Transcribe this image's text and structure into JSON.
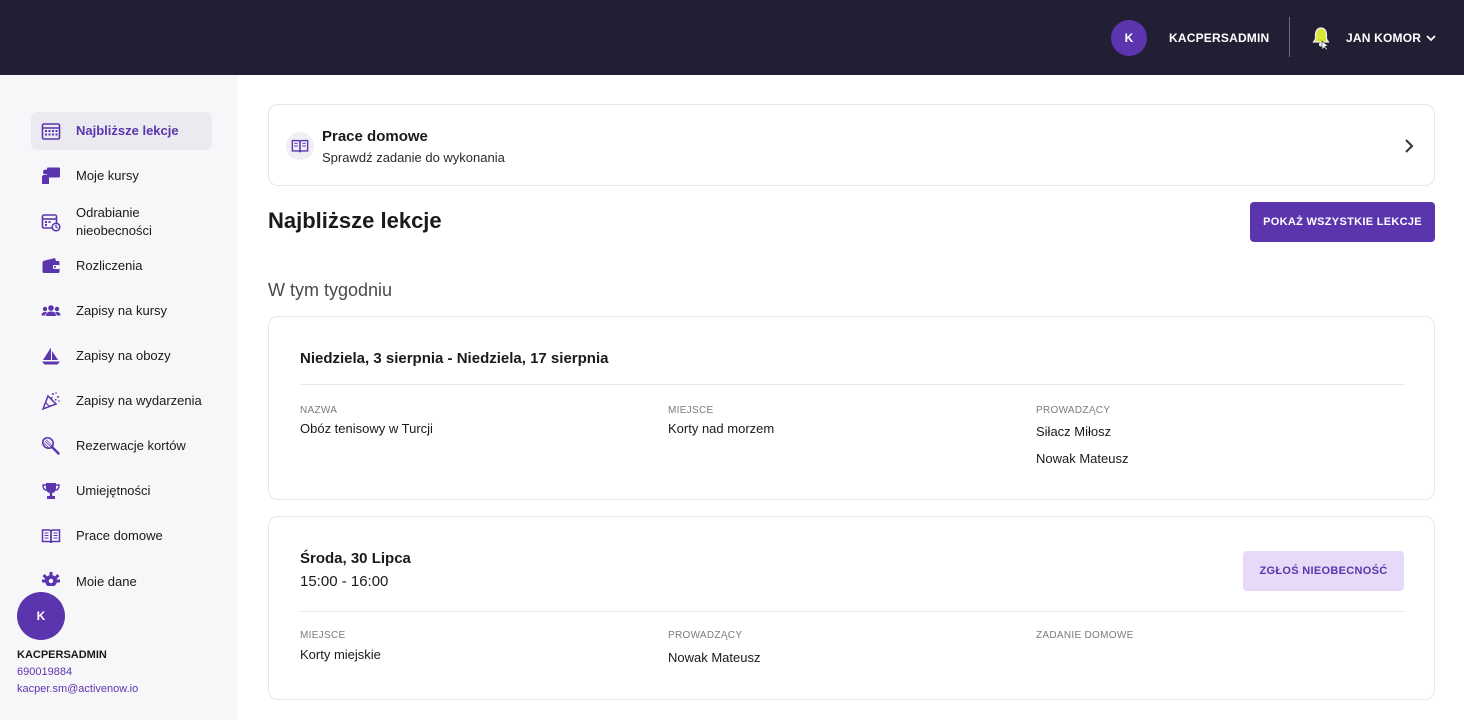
{
  "header": {
    "avatar_initial": "K",
    "username": "KACPERSADMIN",
    "user_name": "JAN KOMOR"
  },
  "sidebar": {
    "items": [
      {
        "label": "Najbliższe lekcje",
        "icon": "calendar-icon",
        "active": true
      },
      {
        "label": "Moje kursy",
        "icon": "teacher-board-icon"
      },
      {
        "label": "Odrabianie nieobecności",
        "icon": "calendar-refresh-icon"
      },
      {
        "label": "Rozliczenia",
        "icon": "wallet-icon"
      },
      {
        "label": "Zapisy na kursy",
        "icon": "users-icon"
      },
      {
        "label": "Zapisy na obozy",
        "icon": "sailboat-icon"
      },
      {
        "label": "Zapisy na wydarzenia",
        "icon": "party-popper-icon"
      },
      {
        "label": "Rezerwacje kortów",
        "icon": "tennis-racket-icon"
      },
      {
        "label": "Umiejętności",
        "icon": "trophy-icon"
      },
      {
        "label": "Prace domowe",
        "icon": "book-icon"
      },
      {
        "label": "Moje dane",
        "icon": "gear-icon"
      }
    ],
    "profile": {
      "avatar_initial": "K",
      "name": "KACPERSADMIN",
      "phone": "690019884",
      "email": "kacper.sm@activenow.io"
    }
  },
  "homework": {
    "title": "Prace domowe",
    "subtitle": "Sprawdź zadanie do wykonania"
  },
  "page": {
    "title": "Najbliższe lekcje",
    "show_all_button": "POKAŻ WSZYSTKIE LEKCJE",
    "week_title": "W tym tygodniu"
  },
  "lessons": [
    {
      "title": "Niedziela, 3 sierpnia - Niedziela, 17 sierpnia",
      "fields": [
        {
          "label": "NAZWA",
          "values": [
            "Obóz tenisowy w Turcji"
          ]
        },
        {
          "label": "MIEJSCE",
          "values": [
            "Korty nad morzem"
          ]
        },
        {
          "label": "PROWADZĄCY",
          "values": [
            "Siłacz Miłosz",
            "Nowak Mateusz"
          ]
        }
      ]
    },
    {
      "title": "Środa, 30 Lipca",
      "time": "15:00 - 16:00",
      "absence_button": "ZGŁOŚ NIEOBECNOŚĆ",
      "fields": [
        {
          "label": "MIEJSCE",
          "values": [
            "Korty miejskie"
          ]
        },
        {
          "label": "PROWADZĄCY",
          "values": [
            "Nowak Mateusz"
          ]
        },
        {
          "label": "ZADANIE DOMOWE",
          "values": []
        }
      ]
    }
  ],
  "colors": {
    "topbar": "#221f35",
    "accent": "#5b35ad",
    "accent_light": "#e6daf8",
    "sidebar_bg": "#f7f7fa"
  }
}
